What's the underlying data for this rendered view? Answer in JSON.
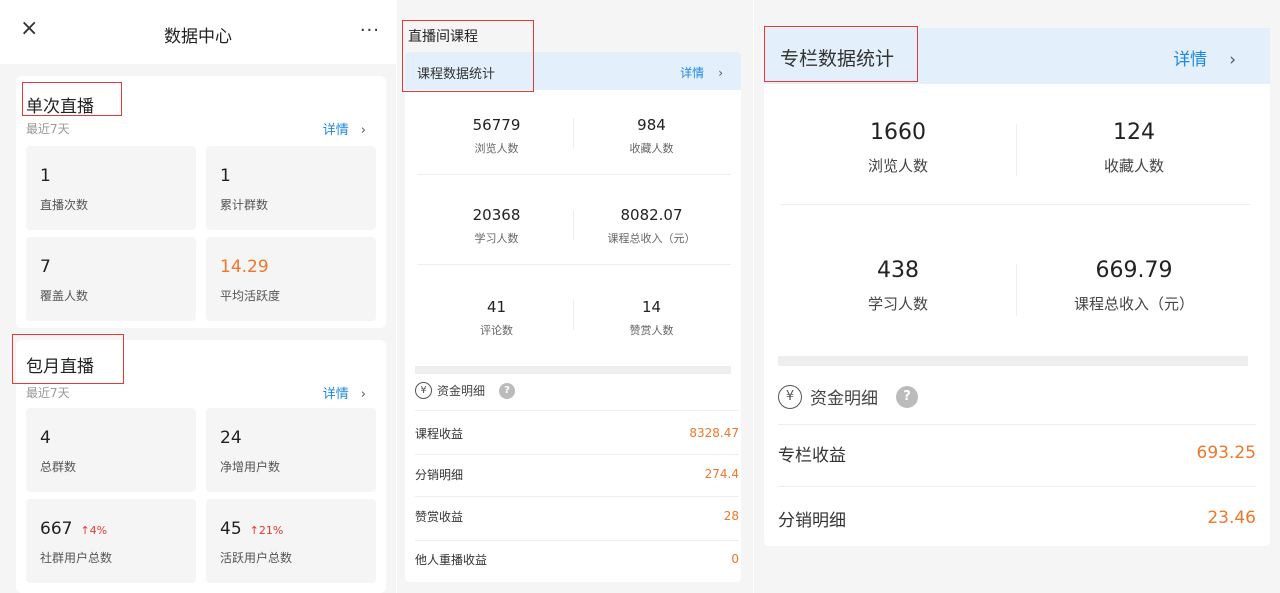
{
  "left_panel": {
    "header_title": "数据中心",
    "close_glyph": "×",
    "more_glyph": "···",
    "single_live": {
      "title": "单次直播",
      "period": "最近7天",
      "detail_label": "详情",
      "tiles": [
        {
          "value": "1",
          "label": "直播次数"
        },
        {
          "value": "1",
          "label": "累计群数"
        },
        {
          "value": "7",
          "label": "覆盖人数"
        },
        {
          "value": "14.29",
          "label": "平均活跃度"
        }
      ]
    },
    "monthly_live": {
      "title": "包月直播",
      "period": "最近7天",
      "detail_label": "详情",
      "tiles": [
        {
          "value": "4",
          "label": "总群数",
          "change": ""
        },
        {
          "value": "24",
          "label": "净增用户数",
          "change": ""
        },
        {
          "value": "667",
          "label": "社群用户总数",
          "change": "↑4%"
        },
        {
          "value": "45",
          "label": "活跃用户总数",
          "change": "↑21%"
        }
      ]
    }
  },
  "middle_panel": {
    "title": "直播间课程",
    "stats_header": "课程数据统计",
    "detail_label": "详情",
    "stats": [
      {
        "value": "56779",
        "label": "浏览人数"
      },
      {
        "value": "984",
        "label": "收藏人数"
      },
      {
        "value": "20368",
        "label": "学习人数"
      },
      {
        "value": "8082.07",
        "label": "课程总收入（元）"
      },
      {
        "value": "41",
        "label": "评论数"
      },
      {
        "value": "14",
        "label": "赞赏人数"
      }
    ],
    "funds_title": "资金明细",
    "funds": [
      {
        "label": "课程收益",
        "amount": "8328.47"
      },
      {
        "label": "分销明细",
        "amount": "274.4"
      },
      {
        "label": "赞赏收益",
        "amount": "28"
      },
      {
        "label": "他人重播收益",
        "amount": "0"
      }
    ]
  },
  "right_panel": {
    "stats_header": "专栏数据统计",
    "detail_label": "详情",
    "stats": [
      {
        "value": "1660",
        "label": "浏览人数"
      },
      {
        "value": "124",
        "label": "收藏人数"
      },
      {
        "value": "438",
        "label": "学习人数"
      },
      {
        "value": "669.79",
        "label": "课程总收入（元）"
      }
    ],
    "funds_title": "资金明细",
    "funds": [
      {
        "label": "专栏收益",
        "amount": "693.25"
      },
      {
        "label": "分销明细",
        "amount": "23.46"
      }
    ]
  },
  "glyphs": {
    "chevron": "›",
    "yen": "¥",
    "help": "?"
  },
  "colors": {
    "accent_blue": "#1e88e5",
    "highlight_red": "#e53935",
    "amount_orange": "#f0762a"
  }
}
